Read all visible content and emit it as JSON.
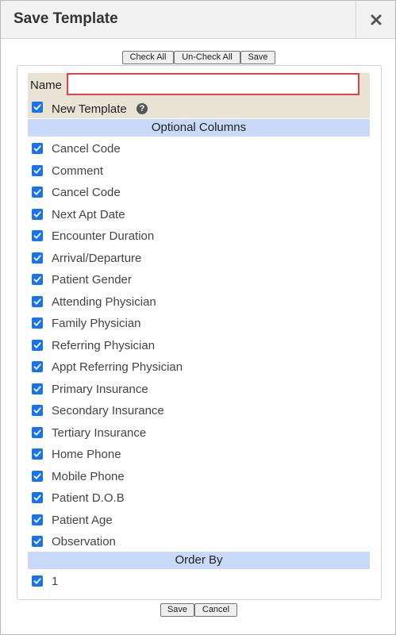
{
  "dialog": {
    "title": "Save Template",
    "close_icon": "close-icon"
  },
  "toolbar": {
    "check_all": "Check All",
    "uncheck_all": "Un-Check All",
    "save": "Save"
  },
  "form": {
    "name_label": "Name",
    "name_value": "",
    "new_template_label": "New Template",
    "new_template_checked": true,
    "help_icon": "question-circle-icon"
  },
  "optional_columns": {
    "header": "Optional Columns",
    "items": [
      {
        "label": "Cancel Code",
        "checked": true
      },
      {
        "label": "Comment",
        "checked": true
      },
      {
        "label": "Cancel Code",
        "checked": true
      },
      {
        "label": "Next Apt Date",
        "checked": true
      },
      {
        "label": "Encounter Duration",
        "checked": true
      },
      {
        "label": "Arrival/Departure",
        "checked": true
      },
      {
        "label": "Patient Gender",
        "checked": true
      },
      {
        "label": "Attending Physician",
        "checked": true
      },
      {
        "label": "Family Physician",
        "checked": true
      },
      {
        "label": "Referring Physician",
        "checked": true
      },
      {
        "label": "Appt Referring Physician",
        "checked": true
      },
      {
        "label": "Primary Insurance",
        "checked": true
      },
      {
        "label": "Secondary Insurance",
        "checked": true
      },
      {
        "label": "Tertiary Insurance",
        "checked": true
      },
      {
        "label": "Home Phone",
        "checked": true
      },
      {
        "label": "Mobile Phone",
        "checked": true
      },
      {
        "label": "Patient D.O.B",
        "checked": true
      },
      {
        "label": "Patient Age",
        "checked": true
      },
      {
        "label": "Observation",
        "checked": true
      }
    ]
  },
  "order_by": {
    "header": "Order By",
    "items": [
      {
        "label": "1",
        "checked": true
      }
    ]
  },
  "footer": {
    "save": "Save",
    "cancel": "Cancel"
  },
  "colors": {
    "checkbox": "#1a73e8",
    "section_header_bg": "#c9daf8",
    "name_row_bg": "#e9e3d6",
    "highlight_border": "#e0434b"
  }
}
